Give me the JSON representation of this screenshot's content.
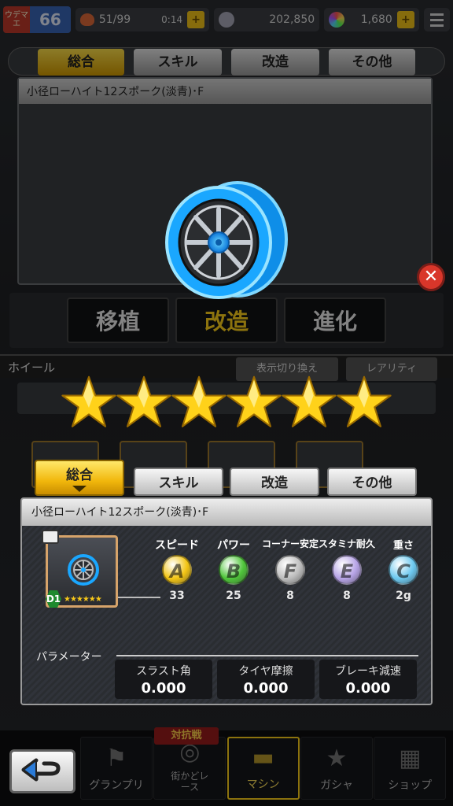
{
  "status_bar": {
    "rank_tag": "ウデマエ",
    "rank_level": "66",
    "stamina": "51/99",
    "timer": "0:14",
    "coins": "202,850",
    "gems": "1,680",
    "plus": "+"
  },
  "background": {
    "tabs": [
      "総合",
      "スキル",
      "改造",
      "その他"
    ],
    "card_title": "小径ローハイト12スポーク(淡青)･F",
    "actions": [
      "移植",
      "改造",
      "進化"
    ],
    "section_label": "ホイール",
    "section_buttons": [
      "表示切り換え",
      "レアリティ"
    ]
  },
  "bottom_nav": {
    "items": [
      "グランプリ",
      "街かどレース",
      "マシン",
      "ガシャ",
      "ショップ"
    ],
    "badge": "対抗戦"
  },
  "overlay": {
    "stars_count": 6,
    "tabs": [
      "総合",
      "スキル",
      "改造",
      "その他"
    ],
    "active_tab": "総合",
    "part_name": "小径ローハイト12スポーク(淡青)･F",
    "thumb_grade": "D1",
    "thumb_stars": "★★★★★★",
    "stats": [
      {
        "label": "スピード",
        "grade": "A",
        "value": "33",
        "color": "#f3c514"
      },
      {
        "label": "パワー",
        "grade": "B",
        "value": "25",
        "color": "#4fc53a"
      },
      {
        "label": "コーナー安定",
        "grade": "F",
        "value": "8",
        "color": "#bdbdbd"
      },
      {
        "label": "スタミナ耐久",
        "grade": "E",
        "value": "8",
        "color": "#b6a3e6"
      },
      {
        "label": "重さ",
        "grade": "C",
        "value": "2g",
        "color": "#6cc8ef"
      }
    ],
    "param_label": "パラメーター",
    "params": [
      {
        "label": "スラスト角",
        "value": "0.000"
      },
      {
        "label": "タイヤ摩擦",
        "value": "0.000"
      },
      {
        "label": "ブレーキ減速",
        "value": "0.000"
      }
    ]
  },
  "colors": {
    "accent_gold": "#ffd21a",
    "wheel_blue": "#1aa7ff",
    "close_red": "#d9362a"
  }
}
